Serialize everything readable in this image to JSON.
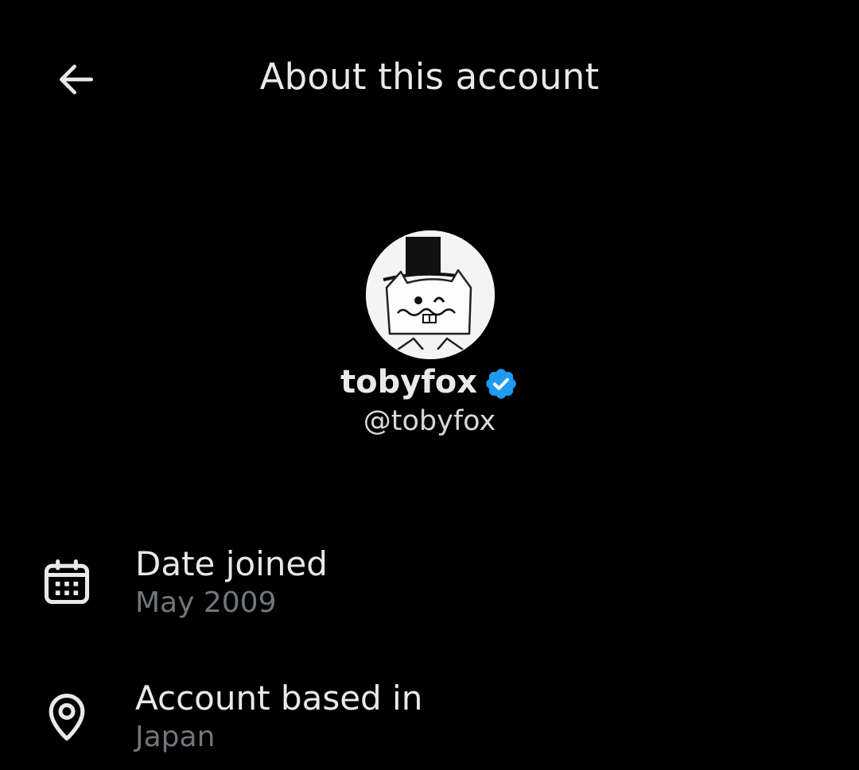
{
  "header": {
    "title": "About this account",
    "back_icon": "arrow-left-icon"
  },
  "profile": {
    "display_name": "tobyfox",
    "handle": "@tobyfox",
    "verified": true,
    "verified_color": "#1d9bf0",
    "avatar_icon": "cat-with-top-hat-avatar"
  },
  "info": [
    {
      "icon": "calendar-icon",
      "label": "Date joined",
      "value": "May 2009"
    },
    {
      "icon": "location-pin-icon",
      "label": "Account based in",
      "value": "Japan"
    }
  ],
  "colors": {
    "background": "#000000",
    "primary_text": "#e7e9ea",
    "secondary_text": "#71767b",
    "accent_blue": "#1d9bf0"
  }
}
